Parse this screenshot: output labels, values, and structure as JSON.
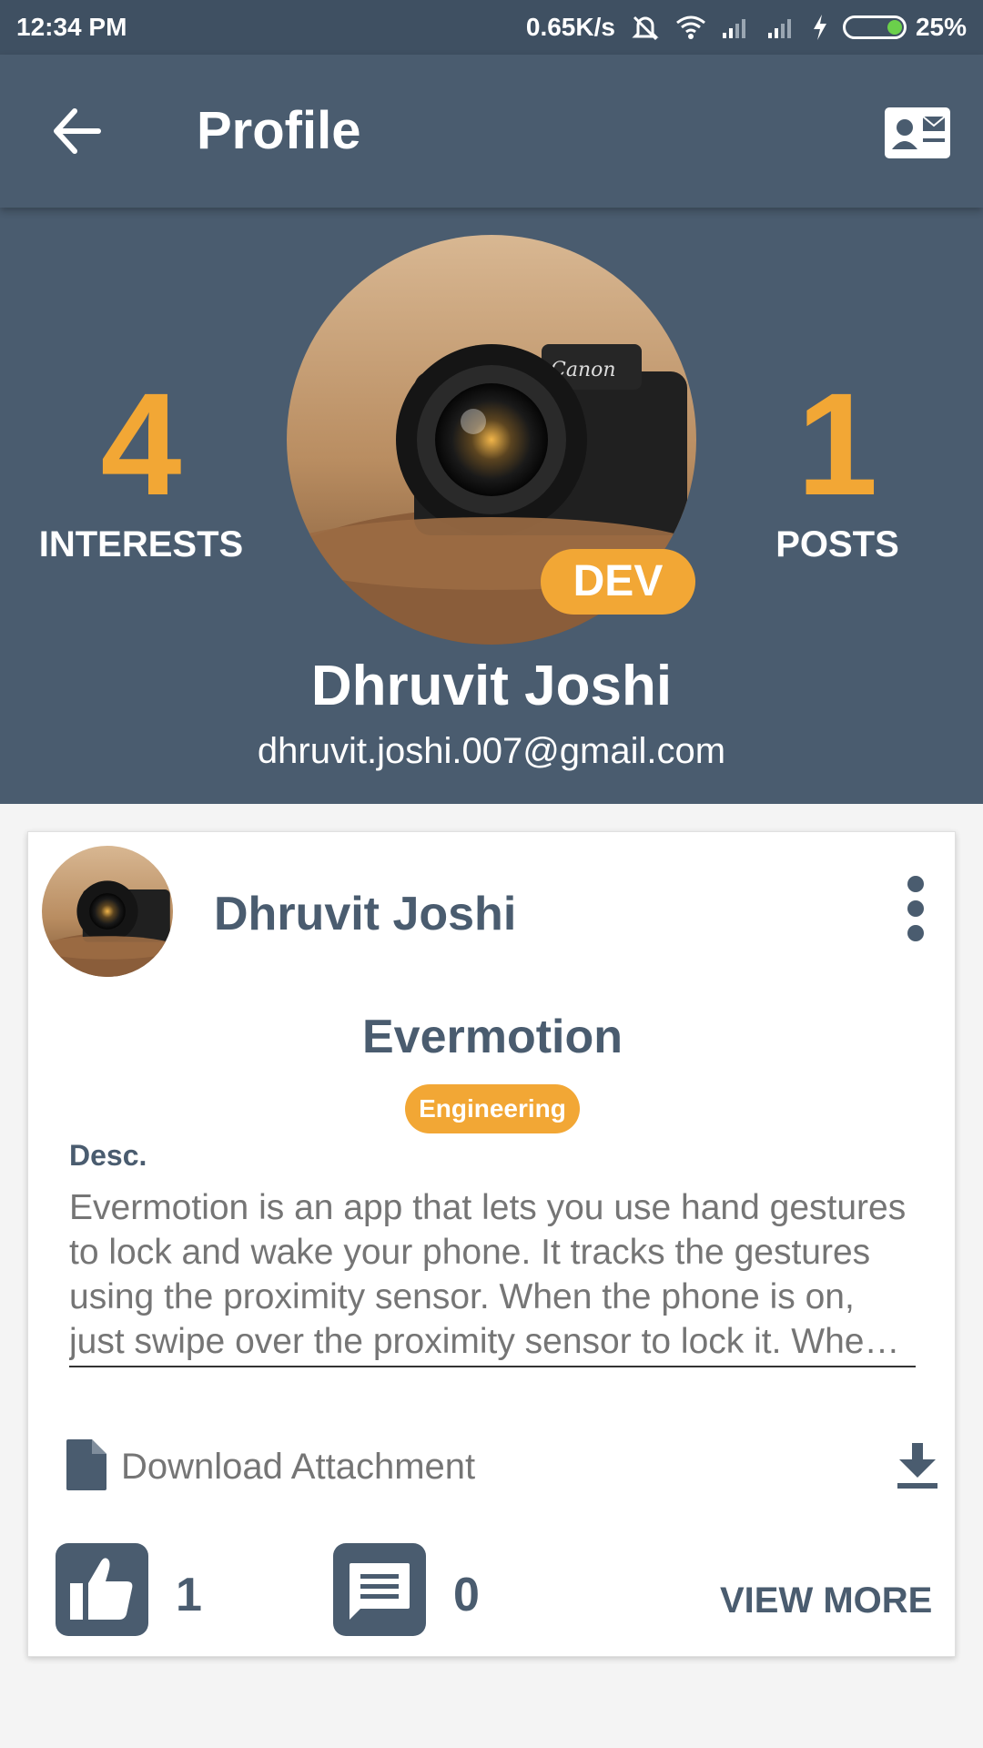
{
  "status_bar": {
    "time": "12:34 PM",
    "speed": "0.65K/s",
    "battery": "25%",
    "icons": [
      "mute-icon",
      "wifi-icon",
      "signal-icon",
      "signal-icon",
      "charging-icon",
      "battery-icon"
    ]
  },
  "appbar": {
    "title": "Profile",
    "back_icon": "arrow-left-icon",
    "contact_icon": "contact-card-icon"
  },
  "profile": {
    "interests_count": "4",
    "interests_label": "INTERESTS",
    "posts_count": "1",
    "posts_label": "POSTS",
    "badge": "DEV",
    "name": "Dhruvit Joshi",
    "email": "dhruvit.joshi.007@gmail.com"
  },
  "post": {
    "author": "Dhruvit Joshi",
    "title": "Evermotion",
    "tag": "Engineering",
    "desc_label": "Desc.",
    "description": "Evermotion is an app that lets you use hand gestures to lock and wake your phone. It tracks the gestures using the proximity sensor. When the phone is on, just swipe over the proximity sensor to lock it. When the phone is off, just swipe a sel…",
    "attachment_label": "Download Attachment",
    "likes": "1",
    "comments": "0",
    "view_more": "VIEW MORE"
  },
  "colors": {
    "primary": "#4a5c6f",
    "status_bar": "#3f5062",
    "accent": "#f2a735"
  }
}
